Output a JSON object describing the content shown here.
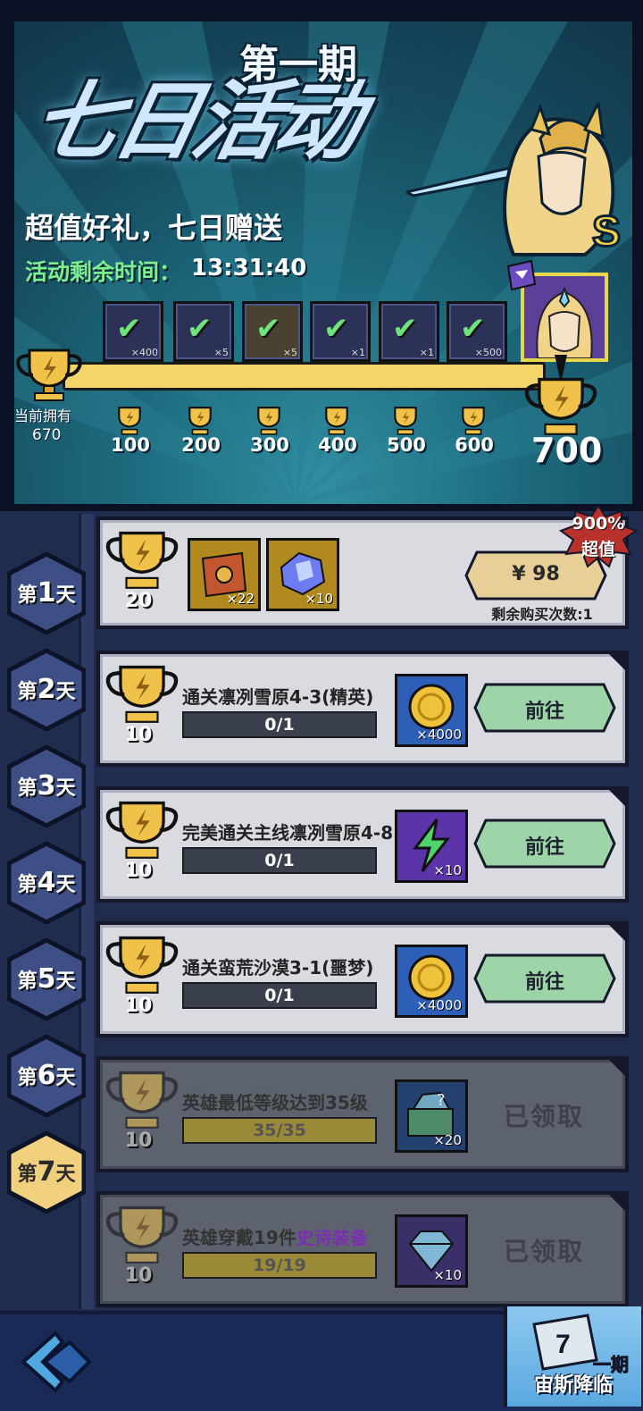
{
  "banner": {
    "period_label": "第一期",
    "event_title": "七日活动",
    "subtitle": "超值好礼，七日赠送",
    "timer_label": "活动剩余时间：",
    "timer_value": "13:31:40",
    "hero_rank": "S",
    "owned_label": "当前拥有",
    "owned_value": "670",
    "milestones": [
      {
        "value": "100",
        "reward_qty": "×400"
      },
      {
        "value": "200",
        "reward_qty": "×5"
      },
      {
        "value": "300",
        "reward_qty": "×5"
      },
      {
        "value": "400",
        "reward_qty": "×1"
      },
      {
        "value": "500",
        "reward_qty": "×1"
      },
      {
        "value": "600",
        "reward_qty": "×500"
      }
    ],
    "final_milestone": "700"
  },
  "days": [
    {
      "label_prefix": "第",
      "num": "1",
      "label_suffix": "天"
    },
    {
      "label_prefix": "第",
      "num": "2",
      "label_suffix": "天"
    },
    {
      "label_prefix": "第",
      "num": "3",
      "label_suffix": "天"
    },
    {
      "label_prefix": "第",
      "num": "4",
      "label_suffix": "天"
    },
    {
      "label_prefix": "第",
      "num": "5",
      "label_suffix": "天"
    },
    {
      "label_prefix": "第",
      "num": "6",
      "label_suffix": "天"
    },
    {
      "label_prefix": "第",
      "num": "7",
      "label_suffix": "天"
    }
  ],
  "purchase_card": {
    "trophy_points": "20",
    "item1_qty": "×22",
    "item2_qty": "×10",
    "price": "¥ 98",
    "remaining": "剩余购买次数:1",
    "value_badge_top": "900%",
    "value_badge_bottom": "超值"
  },
  "tasks": [
    {
      "points": "10",
      "title": "通关凛冽雪原4-3(精英)",
      "progress": "0/1",
      "reward_qty": "×4000",
      "action": "前往"
    },
    {
      "points": "10",
      "title": "完美通关主线凛冽雪原4-8",
      "progress": "0/1",
      "reward_qty": "×10",
      "action": "前往"
    },
    {
      "points": "10",
      "title": "通关蛮荒沙漠3-1(噩梦)",
      "progress": "0/1",
      "reward_qty": "×4000",
      "action": "前往"
    },
    {
      "points": "10",
      "title": "英雄最低等级达到35级",
      "progress": "35/35",
      "reward_qty": "×20",
      "action": "已领取"
    },
    {
      "points": "10",
      "title_main": "英雄穿戴19件",
      "title_epic": "史诗装备",
      "progress": "19/19",
      "reward_qty": "×10",
      "action": "已领取"
    }
  ],
  "bottom": {
    "event_logo_text": "宙斯降临",
    "event_logo_period": "一期"
  },
  "colors": {
    "accent_gold": "#f4d56a",
    "timer_green": "#7cf08e",
    "button_green": "#9ed5a8",
    "price_tan": "#e8cf98"
  }
}
